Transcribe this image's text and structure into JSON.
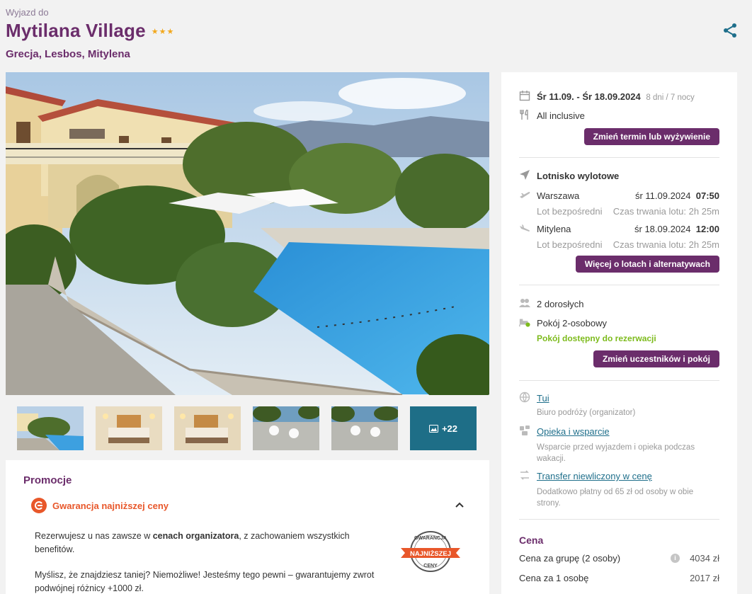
{
  "header": {
    "pre_title": "Wyjazd do",
    "title": "Mytilana Village",
    "stars": "★★★",
    "location": "Grecja, Lesbos, Mitylena"
  },
  "gallery": {
    "more_label": "+22"
  },
  "promo": {
    "heading": "Promocje",
    "item_title": "Gwarancja najniższej ceny",
    "para1_pre": "Rezerwujesz u nas zawsze w ",
    "para1_bold": "cenach organizatora",
    "para1_post": ", z zachowaniem wszystkich benefitów.",
    "para2": "Myślisz, że znajdziesz taniej? Niemożliwe! Jesteśmy tego pewni – gwarantujemy zwrot podwójnej różnicy +1000 zł.",
    "seal_top": "GWARANCJA",
    "seal_mid": "NAJNIŻSZEJ",
    "seal_bottom": "CENY"
  },
  "trip": {
    "dates": "Śr 11.09. - Śr 18.09.2024",
    "duration": "8 dni / 7 nocy",
    "board": "All inclusive",
    "change_btn": "Zmień termin lub wyżywienie"
  },
  "flights": {
    "heading": "Lotnisko wylotowe",
    "outbound": {
      "city": "Warszawa",
      "date": "śr 11.09.2024",
      "time": "07:50",
      "type": "Lot bezpośredni",
      "duration": "Czas trwania lotu: 2h 25m"
    },
    "inbound": {
      "city": "Mitylena",
      "date": "śr 18.09.2024",
      "time": "12:00",
      "type": "Lot bezpośredni",
      "duration": "Czas trwania lotu: 2h 25m"
    },
    "more_btn": "Więcej o lotach i alternatywach"
  },
  "room": {
    "people": "2 dorosłych",
    "room_type": "Pokój 2-osobowy",
    "availability": "Pokój dostępny do rezerwacji",
    "change_btn": "Zmień uczestników i pokój"
  },
  "organizer": {
    "name": "Tui",
    "name_desc": "Biuro podróży (organizator)",
    "care": "Opieka i wsparcie",
    "care_desc": "Wsparcie przed wyjazdem i opieka podczas wakacji.",
    "transfer": "Transfer niewliczony w cenę",
    "transfer_desc": "Dodatkowo płatny od 65 zł od osoby w obie strony."
  },
  "price": {
    "heading": "Cena",
    "group_label": "Cena za grupę (2 osoby)",
    "group_value": "4034 zł",
    "per_person_label": "Cena za 1 osobę",
    "per_person_value": "2017 zł"
  },
  "colors": {
    "brand_purple": "#6b2d6b",
    "promo_orange": "#e8572a",
    "available_green": "#7dbb1c",
    "link_teal": "#1f6f8b"
  }
}
